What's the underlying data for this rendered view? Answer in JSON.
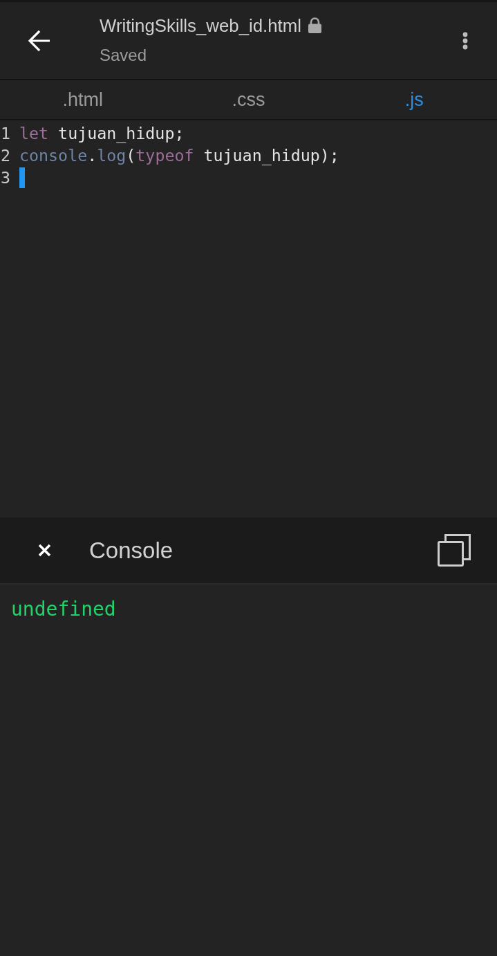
{
  "app_bar": {
    "title": "WritingSkills_web_id.html",
    "locked": true,
    "status": "Saved"
  },
  "tabs": [
    {
      "label": ".html",
      "selected": false
    },
    {
      "label": ".css",
      "selected": false
    },
    {
      "label": ".js",
      "selected": true
    }
  ],
  "editor": {
    "lines": [
      {
        "number": "1",
        "cursor": false,
        "tokens": [
          {
            "text": "let",
            "kind": "keyword"
          },
          {
            "text": " tujuan_hidup;",
            "kind": "plain"
          }
        ]
      },
      {
        "number": "2",
        "cursor": false,
        "tokens": [
          {
            "text": "console",
            "kind": "builtin"
          },
          {
            "text": ".",
            "kind": "plain"
          },
          {
            "text": "log",
            "kind": "builtin"
          },
          {
            "text": "(",
            "kind": "plain"
          },
          {
            "text": "typeof",
            "kind": "keyword"
          },
          {
            "text": " tujuan_hidup);",
            "kind": "plain"
          }
        ]
      },
      {
        "number": "3",
        "cursor": true
      }
    ]
  },
  "console": {
    "title": "Console",
    "output": [
      "undefined"
    ]
  }
}
